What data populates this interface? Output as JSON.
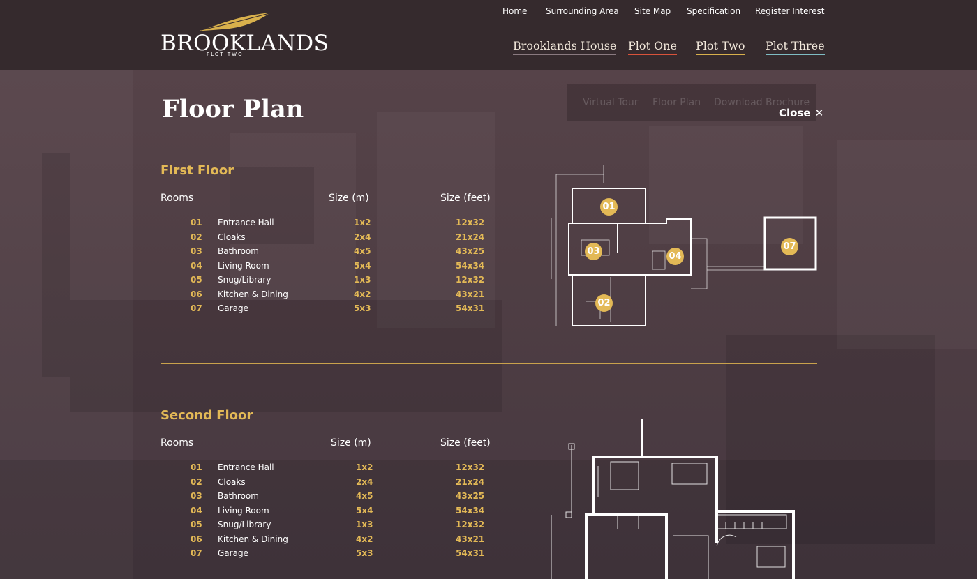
{
  "header": {
    "logo": {
      "name": "BROOKLANDS",
      "sub": "PLOT TWO"
    },
    "top_nav": [
      "Home",
      "Surrounding  Area",
      "Site Map",
      "Specification",
      "Register Interest"
    ],
    "main_nav": [
      "Brooklands House",
      "Plot One",
      "Plot Two",
      "Plot Three"
    ]
  },
  "ghost_tabs": [
    "Virtual Tour",
    "Floor Plan",
    "Download Brochure"
  ],
  "page": {
    "title": "Floor Plan",
    "close_label": "Close",
    "close_icon": "close-icon"
  },
  "first_floor": {
    "title": "First Floor",
    "columns": {
      "rooms": "Rooms",
      "size_m": "Size (m)",
      "size_ft": "Size (feet)"
    },
    "rows": [
      {
        "num": "01",
        "room": "Entrance Hall",
        "m": "1x2",
        "ft": "12x32"
      },
      {
        "num": "02",
        "room": "Cloaks",
        "m": "2x4",
        "ft": "21x24"
      },
      {
        "num": "03",
        "room": "Bathroom",
        "m": "4x5",
        "ft": "43x25"
      },
      {
        "num": "04",
        "room": "Living Room",
        "m": "5x4",
        "ft": "54x34"
      },
      {
        "num": "05",
        "room": "Snug/Library",
        "m": "1x3",
        "ft": "12x32"
      },
      {
        "num": "06",
        "room": "Kitchen & Dining",
        "m": "4x2",
        "ft": "43x21"
      },
      {
        "num": "07",
        "room": "Garage",
        "m": "5x3",
        "ft": "54x31"
      }
    ],
    "markers": [
      "01",
      "03",
      "04",
      "02",
      "07"
    ]
  },
  "second_floor": {
    "title": "Second Floor",
    "columns": {
      "rooms": "Rooms",
      "size_m": "Size (m)",
      "size_ft": "Size (feet)"
    },
    "rows": [
      {
        "num": "01",
        "room": "Entrance Hall",
        "m": "1x2",
        "ft": "12x32"
      },
      {
        "num": "02",
        "room": "Cloaks",
        "m": "2x4",
        "ft": "21x24"
      },
      {
        "num": "03",
        "room": "Bathroom",
        "m": "4x5",
        "ft": "43x25"
      },
      {
        "num": "04",
        "room": "Living Room",
        "m": "5x4",
        "ft": "54x34"
      },
      {
        "num": "05",
        "room": "Snug/Library",
        "m": "1x3",
        "ft": "12x32"
      },
      {
        "num": "06",
        "room": "Kitchen & Dining",
        "m": "4x2",
        "ft": "43x21"
      },
      {
        "num": "07",
        "room": "Garage",
        "m": "5x3",
        "ft": "54x31"
      }
    ]
  },
  "colors": {
    "accent": "#e3b956",
    "header_bg": "#352a2d",
    "nav_plot_one": "#d9533b",
    "nav_plot_two": "#d8b04c",
    "nav_plot_three": "#7fbcc3"
  }
}
